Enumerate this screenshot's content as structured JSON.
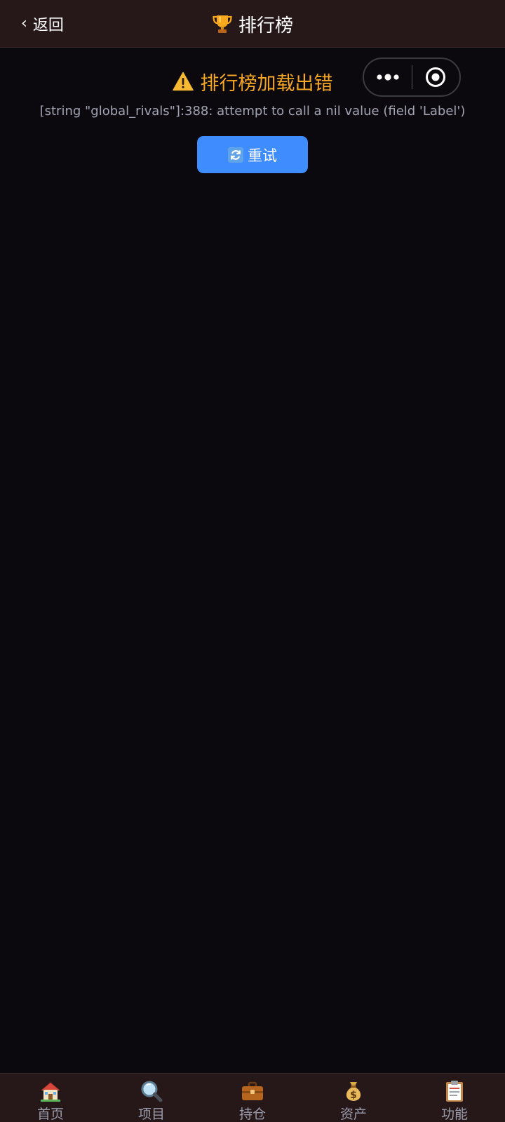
{
  "header": {
    "back_label": "返回",
    "title": "排行榜"
  },
  "error": {
    "title": "排行榜加载出错",
    "message": "[string \"global_rivals\"]:388: attempt to call a nil value (field 'Label')",
    "retry_label": "重试"
  },
  "tabbar": {
    "items": [
      {
        "label": "首页",
        "icon": "house-icon"
      },
      {
        "label": "项目",
        "icon": "magnifier-icon"
      },
      {
        "label": "持仓",
        "icon": "briefcase-icon"
      },
      {
        "label": "资产",
        "icon": "money-bag-icon"
      },
      {
        "label": "功能",
        "icon": "clipboard-icon"
      }
    ]
  },
  "colors": {
    "background": "#0b090e",
    "header_bg": "#261719",
    "warning": "#f5a623",
    "accent": "#3f8cff",
    "muted_text": "#a3a4b3"
  }
}
